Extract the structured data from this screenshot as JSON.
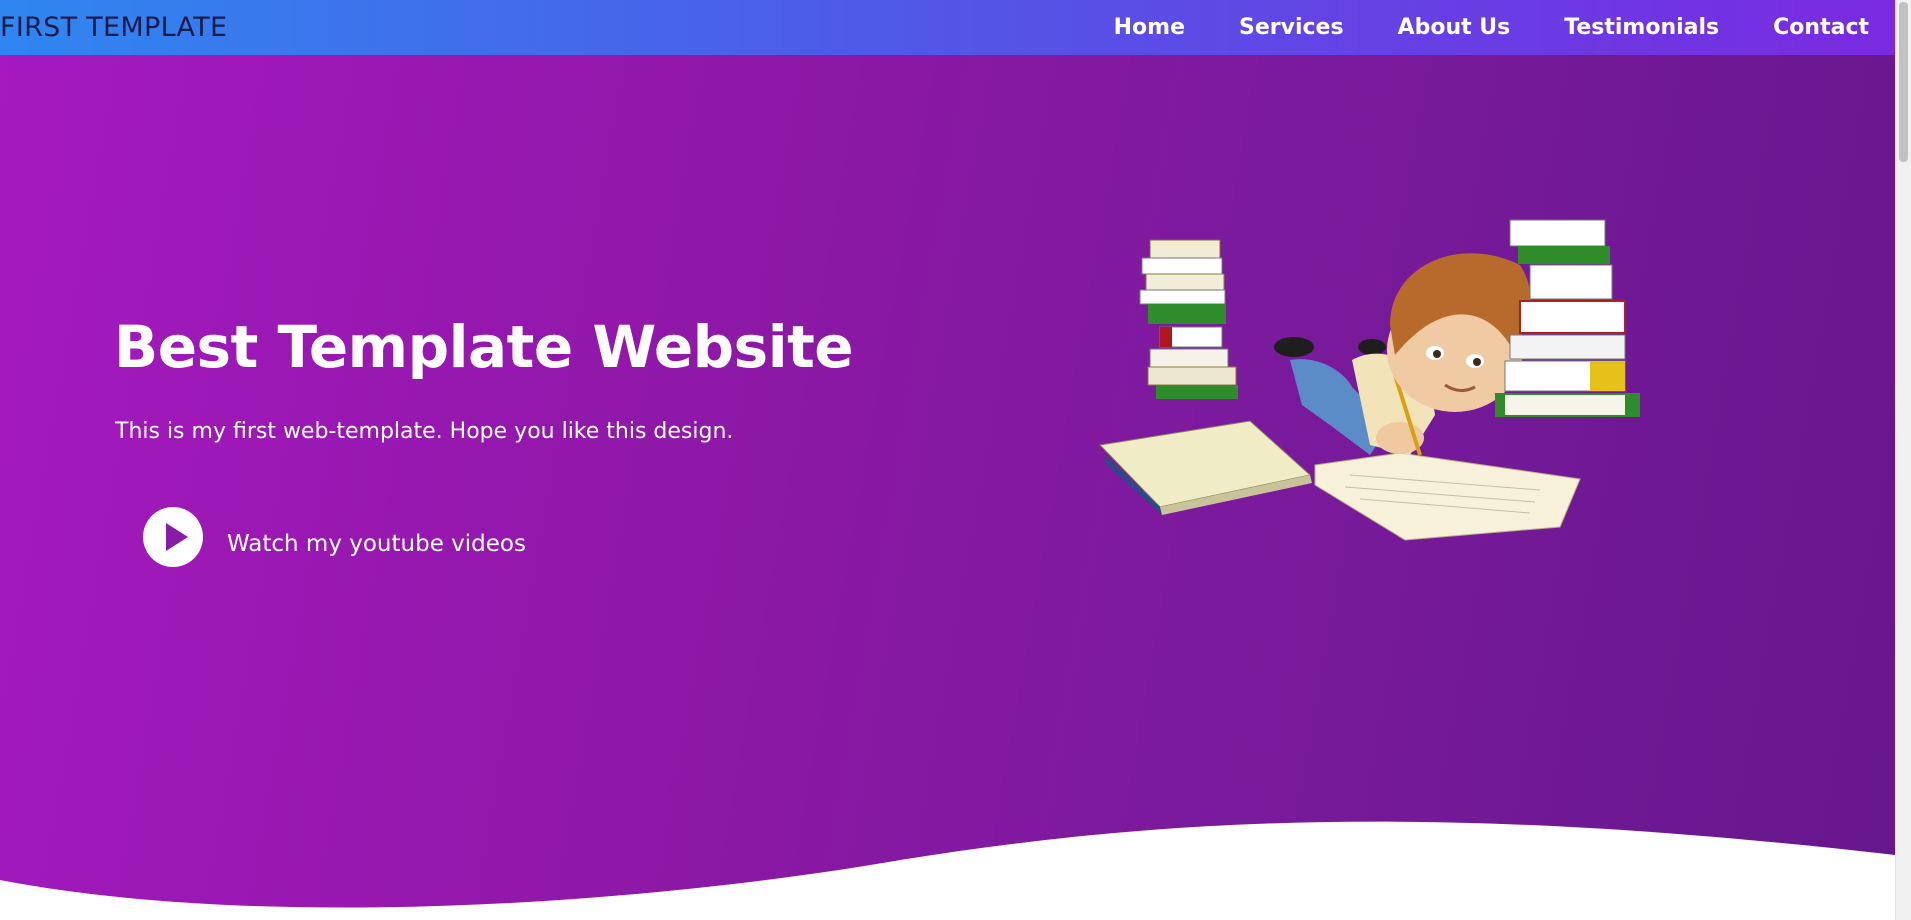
{
  "navbar": {
    "brand": "FIRST TEMPLATE",
    "links": [
      "Home",
      "Services",
      "About Us",
      "Testimonials",
      "Contact"
    ]
  },
  "hero": {
    "title": "Best Template Website",
    "subtitle": "This is my first web-template. Hope you like this design.",
    "cta_label": "Watch my youtube videos",
    "cta_icon": "play-icon"
  },
  "colors": {
    "nav_gradient_start": "#2f86f0",
    "nav_gradient_end": "#7a2ae0",
    "hero_gradient_start": "#a519bf",
    "hero_gradient_end": "#66178d",
    "text": "#ffffff"
  }
}
